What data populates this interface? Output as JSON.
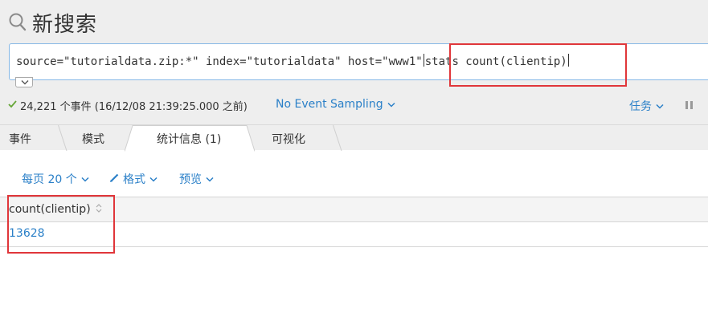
{
  "header": {
    "title": "新搜索"
  },
  "search": {
    "query_prefix": "source=\"tutorialdata.zip:*\" index=\"tutorialdata\" host=\"www1\"",
    "query_suffix": "stats count(clientip)"
  },
  "status": {
    "event_summary": "24,221 个事件 (16/12/08 21:39:25.000 之前)",
    "sampling_label": "No Event Sampling",
    "jobs_label": "任务"
  },
  "tabs": [
    {
      "label": "事件"
    },
    {
      "label": "模式"
    },
    {
      "label": "统计信息 (1)"
    },
    {
      "label": "可视化"
    }
  ],
  "active_tab": 2,
  "controls": {
    "per_page_label": "每页 20 个",
    "format_label": "格式",
    "preview_label": "预览"
  },
  "table": {
    "columns": [
      "count(clientip)"
    ],
    "rows": [
      [
        "13628"
      ]
    ]
  },
  "colors": {
    "accent": "#2b80c8",
    "highlight": "#e0363a",
    "success": "#65a637"
  },
  "icons": [
    "search-icon",
    "chevron-down-icon",
    "check-icon",
    "pause-icon",
    "pencil-icon",
    "sort-icon"
  ]
}
